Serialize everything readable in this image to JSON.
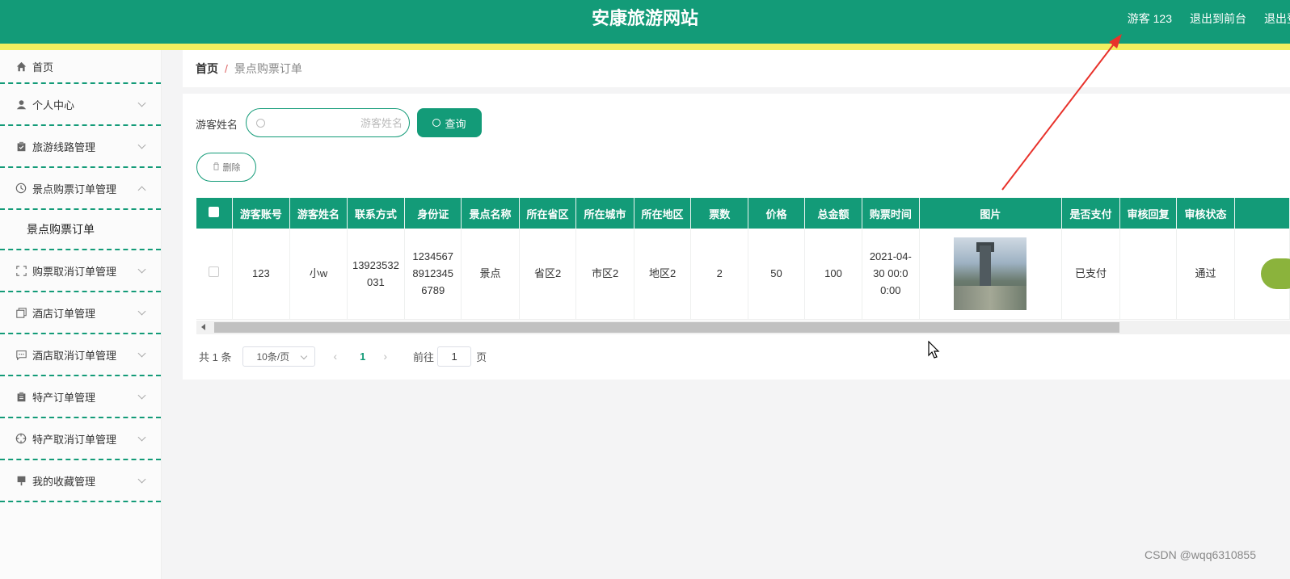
{
  "header": {
    "title": "安康旅游网站",
    "user": "游客 123",
    "back_to_front": "退出到前台",
    "logout": "退出登"
  },
  "sidebar": {
    "items": [
      {
        "label": "首页",
        "icon": "home-icon"
      },
      {
        "label": "个人中心",
        "icon": "user-icon"
      },
      {
        "label": "旅游线路管理",
        "icon": "clipboard-icon"
      },
      {
        "label": "景点购票订单管理",
        "icon": "clock-icon"
      },
      {
        "label": "购票取消订单管理",
        "icon": "expand-icon"
      },
      {
        "label": "酒店订单管理",
        "icon": "copy-icon"
      },
      {
        "label": "酒店取消订单管理",
        "icon": "chat-icon"
      },
      {
        "label": "特产订单管理",
        "icon": "clipboard-icon"
      },
      {
        "label": "特产取消订单管理",
        "icon": "target-icon"
      },
      {
        "label": "我的收藏管理",
        "icon": "collection-icon"
      }
    ],
    "subitem": "景点购票订单"
  },
  "breadcrumb": {
    "home": "首页",
    "separator": "/",
    "current": "景点购票订单"
  },
  "search": {
    "label": "游客姓名",
    "placeholder": "游客姓名",
    "button": "查询"
  },
  "actions": {
    "delete": "删除"
  },
  "table": {
    "headers": [
      "游客账号",
      "游客姓名",
      "联系方式",
      "身份证",
      "景点名称",
      "所在省区",
      "所在城市",
      "所在地区",
      "票数",
      "价格",
      "总金额",
      "购票时间",
      "图片",
      "是否支付",
      "审核回复",
      "审核状态"
    ],
    "rows": [
      {
        "account": "123",
        "name": "小w",
        "phone": "13923532031",
        "id_card": "123456789123456789",
        "spot": "景点",
        "province": "省区2",
        "city": "市区2",
        "district": "地区2",
        "tickets": "2",
        "price": "50",
        "total": "100",
        "time": "2021-04-30 00:00:00",
        "paid": "已支付",
        "reply": "",
        "status": "通过"
      }
    ]
  },
  "pagination": {
    "total": "共 1 条",
    "page_size": "10条/页",
    "current_page": "1",
    "goto_label": "前往",
    "goto_value": "1",
    "goto_unit": "页"
  },
  "watermark": "CSDN @wqq6310855",
  "colors": {
    "primary": "#139b78",
    "stripe": "#f3ee5f",
    "annotation": "#e8322b"
  }
}
